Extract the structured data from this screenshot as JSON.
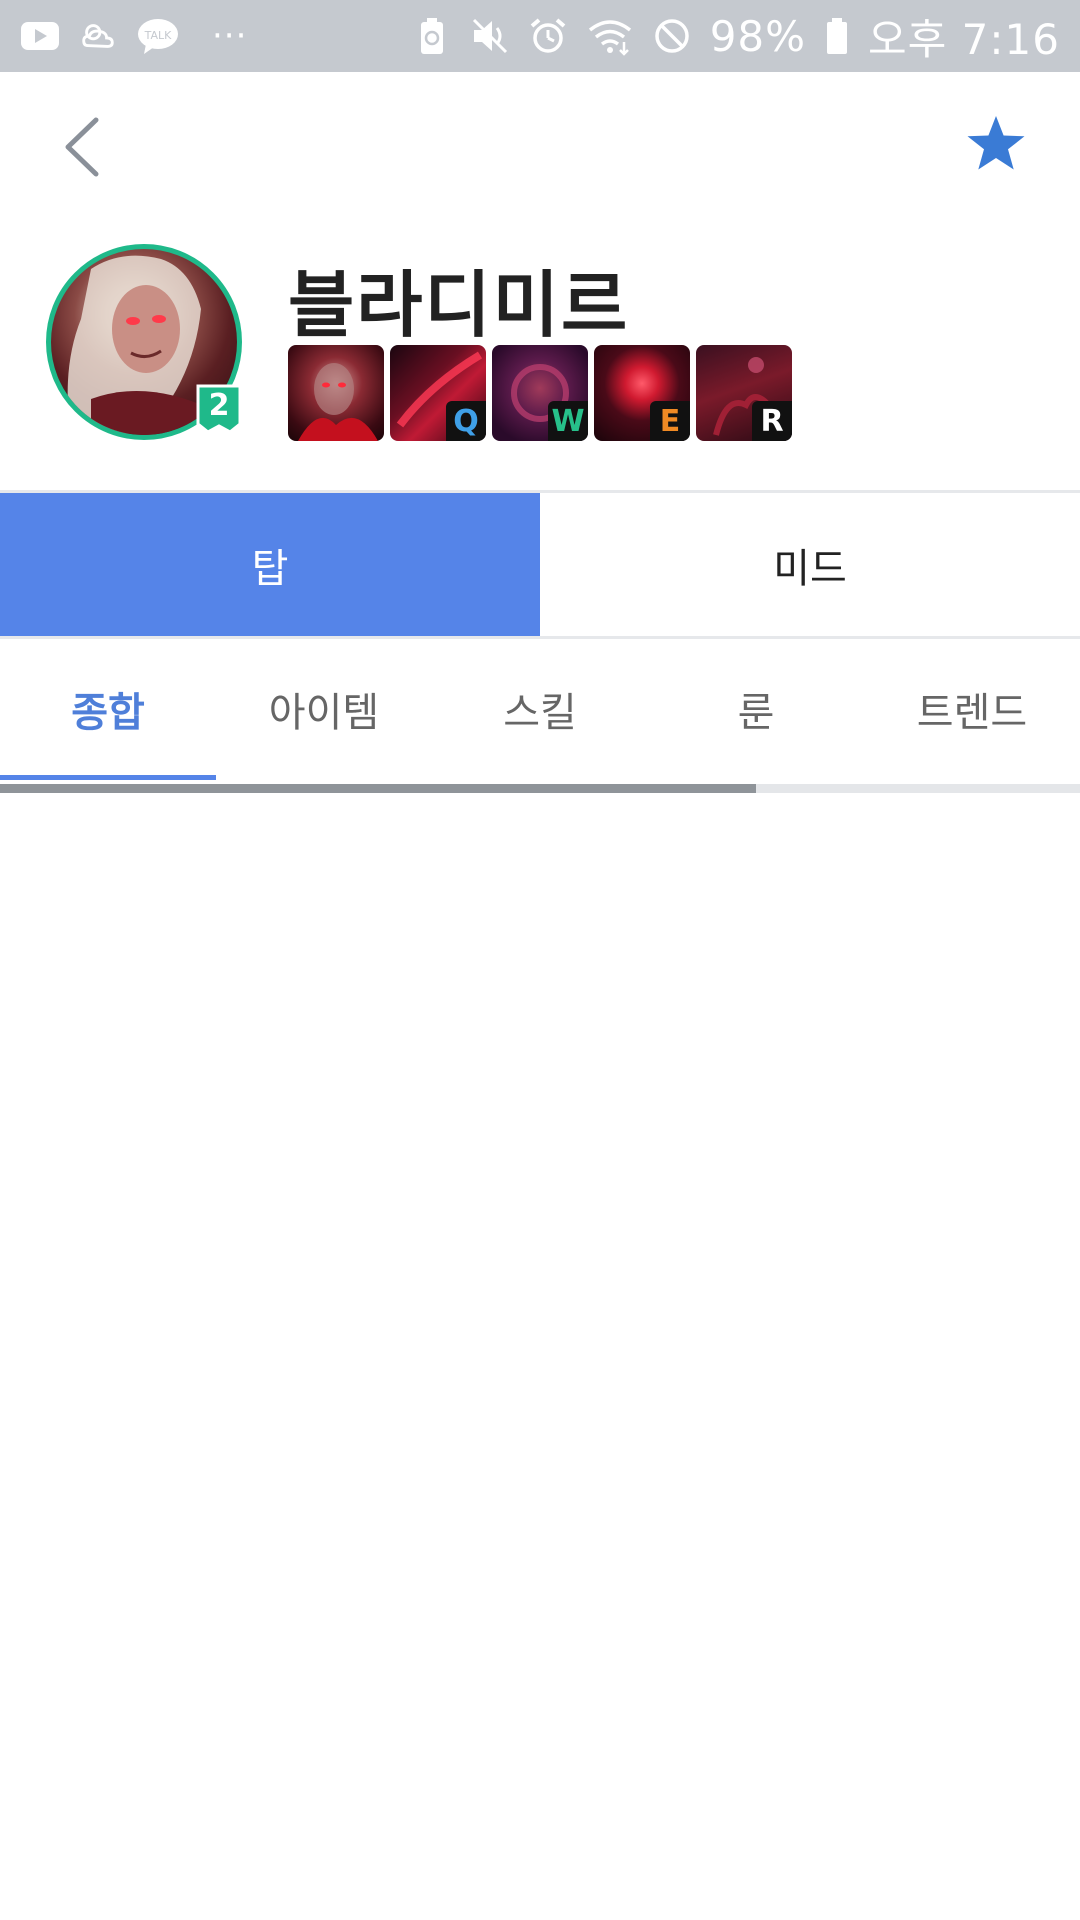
{
  "status_bar": {
    "left_icons": [
      "youtube-icon",
      "weather-icon",
      "kakaotalk-icon",
      "more-dots-icon"
    ],
    "kakao_label": "TALK",
    "more_label": "···",
    "right_icons": [
      "battery-saver-icon",
      "mute-icon",
      "alarm-icon",
      "wifi-icon",
      "do-not-disturb-icon"
    ],
    "battery_text": "98%",
    "time_text": "오후 7:16",
    "background": "#c5c9cf"
  },
  "header": {
    "back_icon": "chevron-left-icon",
    "favorite_icon": "star-icon",
    "favorite_color": "#3a7bd5"
  },
  "champion": {
    "name": "블라디미르",
    "tier": "2",
    "ring_color": "#1fb98a",
    "skills": [
      {
        "key": "",
        "key_color": "#ffffff",
        "name": "passive"
      },
      {
        "key": "Q",
        "key_color": "#3fa0e8",
        "name": "q"
      },
      {
        "key": "W",
        "key_color": "#27c08a",
        "name": "w"
      },
      {
        "key": "E",
        "key_color": "#f08a24",
        "name": "e"
      },
      {
        "key": "R",
        "key_color": "#ffffff",
        "name": "r"
      }
    ]
  },
  "position_tabs": {
    "items": [
      {
        "label": "탑",
        "active": true
      },
      {
        "label": "미드",
        "active": false
      }
    ],
    "active_color": "#5584e8"
  },
  "sub_tabs": {
    "items": [
      {
        "label": "종합",
        "active": true
      },
      {
        "label": "아이템",
        "active": false
      },
      {
        "label": "스킬",
        "active": false
      },
      {
        "label": "룬",
        "active": false
      },
      {
        "label": "트렌드",
        "active": false
      }
    ],
    "active_color": "#4f7fd9"
  },
  "loading_progress": 0.7
}
